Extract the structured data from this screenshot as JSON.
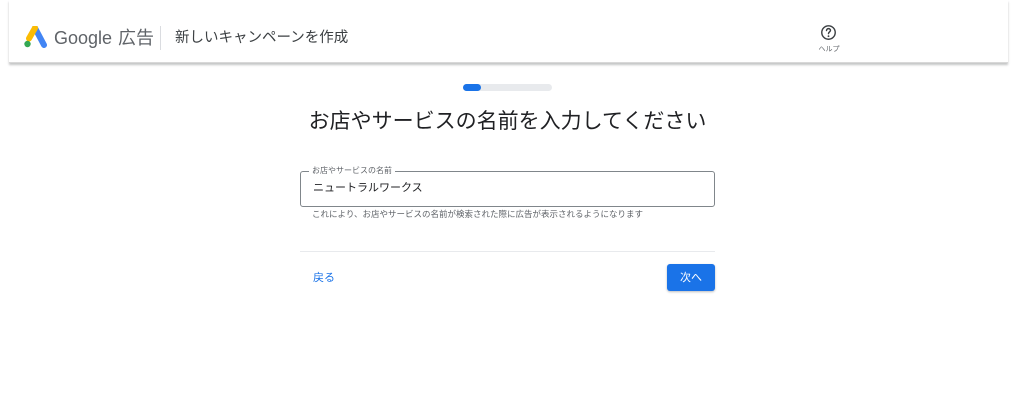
{
  "header": {
    "logo_google": "Google",
    "logo_ads": "広告",
    "title": "新しいキャンペーンを作成",
    "help_label": "ヘルプ",
    "help_icon": "help-circle-icon",
    "logo_icon": "google-ads-logo-icon"
  },
  "progress": {
    "value_fraction": 0.2
  },
  "main": {
    "title": "お店やサービスの名前を入力してください",
    "field": {
      "label": "お店やサービスの名前",
      "value": "ニュートラルワークス"
    },
    "helper_text": "これにより、お店やサービスの名前が検索された際に広告が表示されるようになります"
  },
  "footer": {
    "back_label": "戻る",
    "next_label": "次へ"
  },
  "colors": {
    "accent": "#1a73e8",
    "logo_blue": "#4285f4",
    "logo_yellow": "#fbbc04",
    "logo_green": "#34a853",
    "track": "#e8eaed"
  }
}
